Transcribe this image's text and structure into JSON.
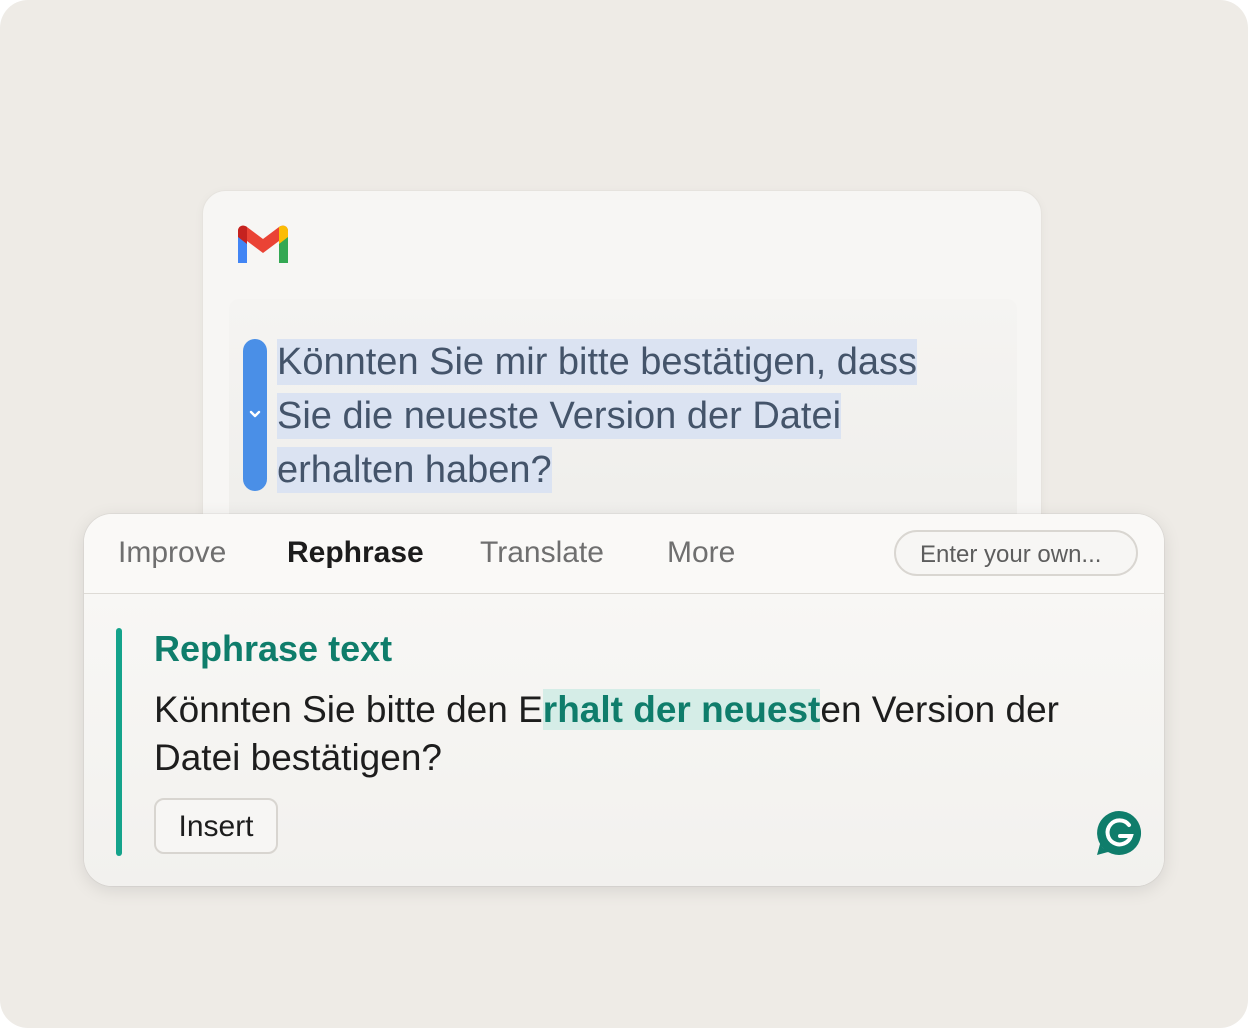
{
  "email": {
    "app_icon": "gmail-icon",
    "selected_text": "Könnten Sie mir bitte bestätigen, dass Sie die neueste Version der Datei erhalten haben?"
  },
  "popup": {
    "tabs": [
      {
        "label": "Improve",
        "active": false
      },
      {
        "label": "Rephrase",
        "active": true
      },
      {
        "label": "Translate",
        "active": false
      },
      {
        "label": "More",
        "active": false
      }
    ],
    "custom_prompt_placeholder": "Enter your own...",
    "result": {
      "title": "Rephrase text",
      "text_before": "Könnten Sie bitte den E",
      "text_changed": "rhalt der neuest",
      "text_after": "en Version der Datei bestätigen?"
    },
    "insert_label": "Insert",
    "brand_icon": "grammarly-icon"
  },
  "colors": {
    "accent_teal": "#0f7d6b",
    "selection_blue": "#4a8fe7"
  }
}
